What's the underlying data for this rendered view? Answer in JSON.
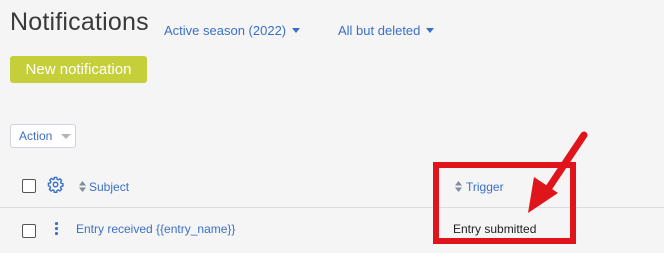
{
  "header": {
    "title": "Notifications",
    "season_filter": "Active season (2022)",
    "status_filter": "All but deleted"
  },
  "toolbar": {
    "new_button_label": "New notification",
    "action_label": "Action"
  },
  "table": {
    "columns": [
      "Subject",
      "Trigger"
    ],
    "rows": [
      {
        "subject": "Entry received {{entry_name}}",
        "trigger": "Entry submitted"
      }
    ]
  },
  "annotation": {
    "highlight_color": "#e0141b"
  },
  "colors": {
    "link": "#3b6fc9",
    "primary_button": "#c5cf3a",
    "background": "#f5f5f5"
  }
}
